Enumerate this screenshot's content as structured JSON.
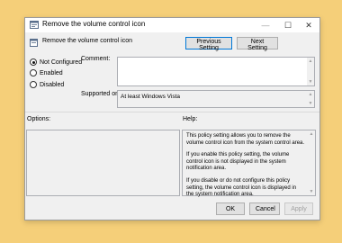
{
  "window": {
    "title": "Remove the volume control icon",
    "controls": {
      "minimize": "—",
      "maximize": "☐",
      "close": "✕"
    }
  },
  "header": {
    "setting_name": "Remove the volume control icon",
    "previous_button": "Previous Setting",
    "next_button": "Next Setting"
  },
  "state_options": [
    {
      "label": "Not Configured",
      "selected": true
    },
    {
      "label": "Enabled",
      "selected": false
    },
    {
      "label": "Disabled",
      "selected": false
    }
  ],
  "comment": {
    "label": "Comment:",
    "value": ""
  },
  "supported_on": {
    "label": "Supported on:",
    "value": "At least Windows Vista"
  },
  "options": {
    "label": "Options:"
  },
  "help": {
    "label": "Help:",
    "paragraphs": [
      "This policy setting allows you to remove the volume control icon from the system control area.",
      "If you enable this policy setting, the volume control icon is not displayed in the system notification area.",
      "If you disable or do not configure this policy setting, the volume control icon is displayed in the system notification area."
    ]
  },
  "footer": {
    "ok": "OK",
    "cancel": "Cancel",
    "apply": "Apply"
  },
  "icons": [
    "app-icon",
    "policy-icon",
    "scroll-up-icon",
    "scroll-down-icon"
  ],
  "colors": {
    "background": "#f5cf79",
    "dialog": "#f0f0f0",
    "focus_border": "#0078d7"
  }
}
